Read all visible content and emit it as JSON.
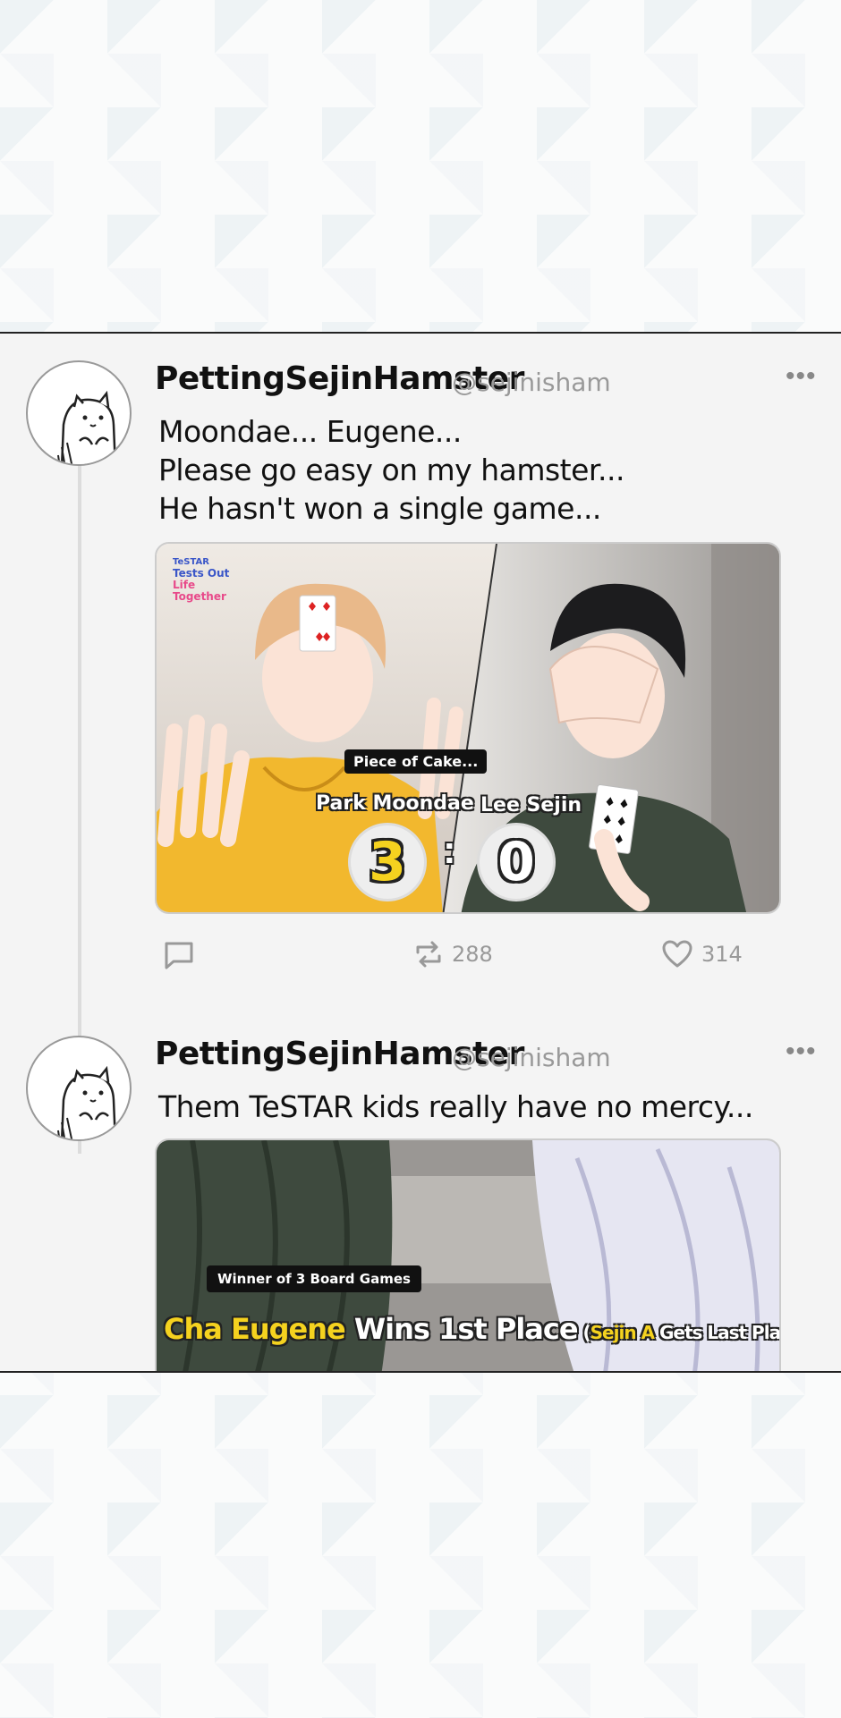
{
  "posts": [
    {
      "display_name": "PettingSejinHamster",
      "handle": "@sejinisham",
      "more_label": "•••",
      "text_lines": [
        "Moondae... Eugene...",
        "Please go easy on my hamster...",
        "He hasn't won a single game..."
      ],
      "media": {
        "logo_lines": [
          "TeSTAR",
          "Tests Out",
          "Life",
          "Together"
        ],
        "caption": "Piece of Cake...",
        "left_name": "Park Moondae",
        "right_name": "Lee Sejin",
        "left_score": "3",
        "right_score": "0",
        "score_sep": ":"
      },
      "actions": {
        "retweets": "288",
        "likes": "314"
      }
    },
    {
      "display_name": "PettingSejinHamster",
      "handle": "@sejinisham",
      "more_label": "•••",
      "text_lines": [
        "Them TeSTAR kids really have no mercy..."
      ],
      "media": {
        "tag": "Winner of 3 Board Games",
        "headline_yellow": "Cha Eugene",
        "headline_white": " Wins 1st Place",
        "headline_paren_open": " (",
        "headline_paren_yellow": "Sejin A",
        "headline_paren_rest": " Gets Last Place)"
      }
    }
  ],
  "colors": {
    "accent_yellow": "#f5d21f",
    "hoodie": "#f2b82e",
    "sweater": "#3e4a3e"
  },
  "icons": [
    "reply-icon",
    "retweet-icon",
    "heart-icon",
    "more-icon",
    "hamster-avatar"
  ]
}
